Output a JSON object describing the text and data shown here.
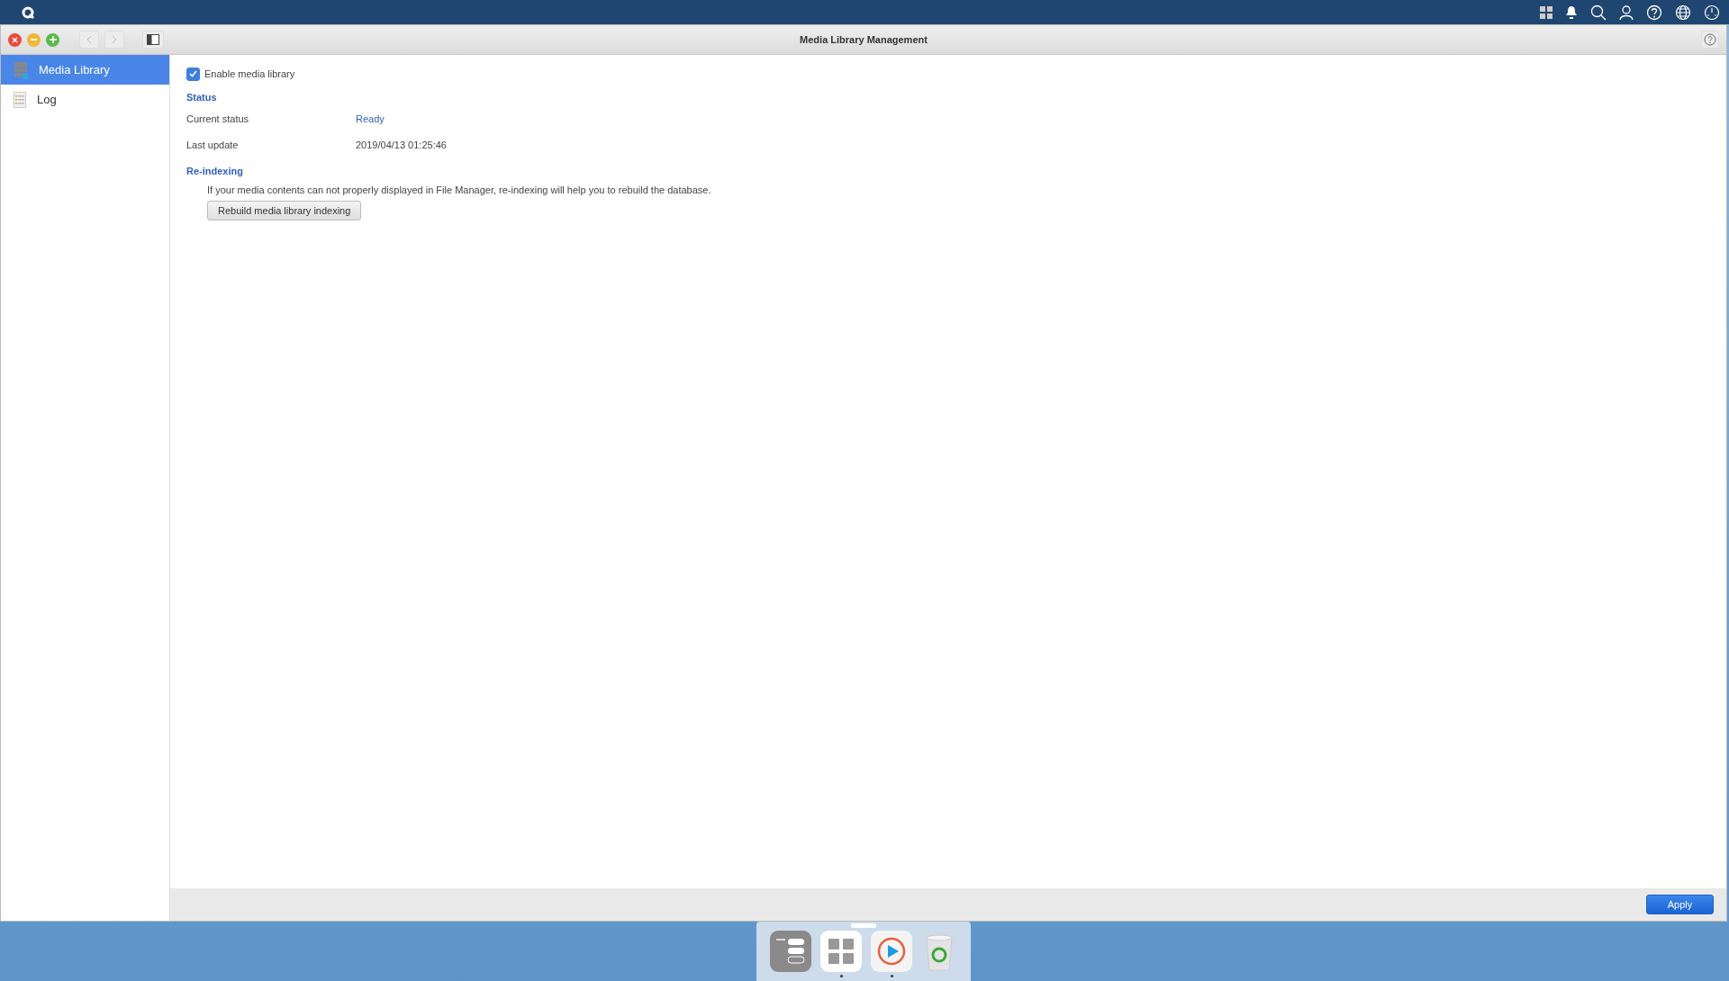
{
  "window": {
    "title": "Media Library Management"
  },
  "sidebar": {
    "items": [
      {
        "label": "Media Library",
        "kind": "database",
        "selected": true
      },
      {
        "label": "Log",
        "kind": "log",
        "selected": false
      }
    ]
  },
  "enable": {
    "label": "Enable media library",
    "checked": true
  },
  "status": {
    "heading": "Status",
    "rows": [
      {
        "label": "Current status",
        "value": "Ready",
        "kind": "state"
      },
      {
        "label": "Last update",
        "value": "2019/04/13 01:25:46",
        "kind": "plain"
      }
    ]
  },
  "reindexing": {
    "heading": "Re-indexing",
    "description": "If your media contents can not properly displayed in File Manager, re-indexing will help you to rebuild the database.",
    "button": "Rebuild media library indexing"
  },
  "footer": {
    "apply": "Apply"
  },
  "dock": [
    {
      "kind": "control",
      "running": false
    },
    {
      "kind": "apps",
      "running": true
    },
    {
      "kind": "media",
      "running": true
    },
    {
      "kind": "trash",
      "running": false
    }
  ]
}
